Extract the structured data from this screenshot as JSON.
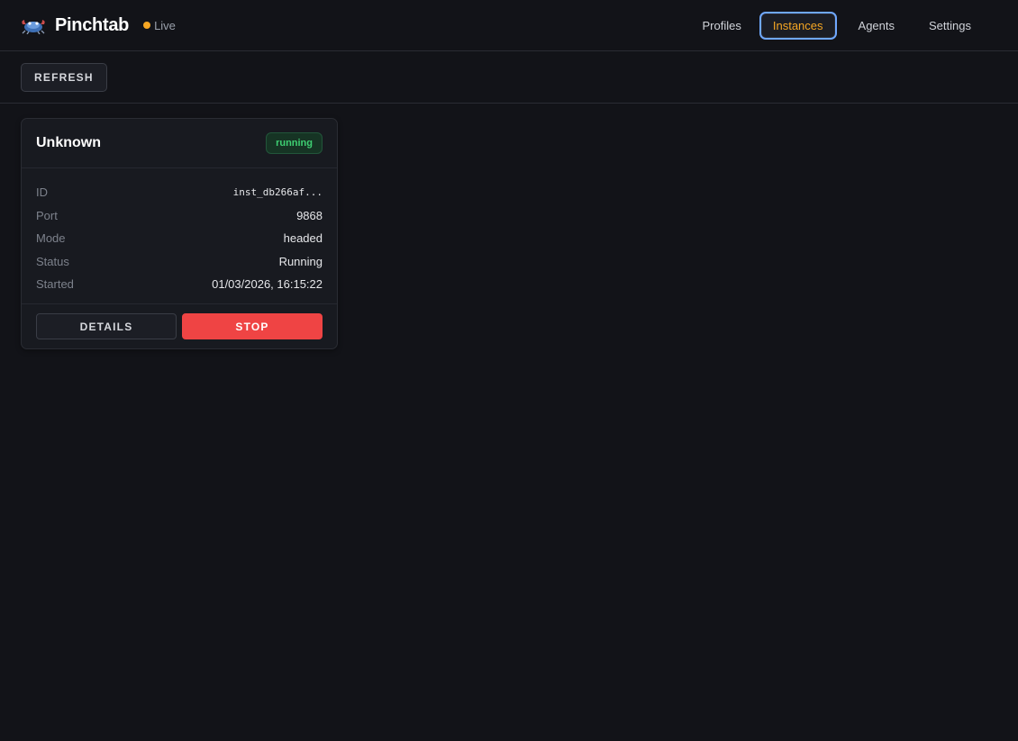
{
  "app": {
    "brand_name": "Pinchtab",
    "status_label": "Live",
    "status_color": "#f5a623",
    "logo_icon": "crab-logo-icon"
  },
  "nav": {
    "items": [
      {
        "label": "Profiles",
        "active": false
      },
      {
        "label": "Instances",
        "active": true
      },
      {
        "label": "Agents",
        "active": false
      },
      {
        "label": "Settings",
        "active": false
      }
    ]
  },
  "toolbar": {
    "refresh_label": "REFRESH"
  },
  "instance_card": {
    "title": "Unknown",
    "status_badge": "running",
    "fields": [
      {
        "key": "ID",
        "value": "inst_db266af..."
      },
      {
        "key": "Port",
        "value": "9868"
      },
      {
        "key": "Mode",
        "value": "headed"
      },
      {
        "key": "Status",
        "value": "Running"
      },
      {
        "key": "Started",
        "value": "01/03/2026, 16:15:22"
      }
    ],
    "details_label": "DETAILS",
    "stop_label": "STOP"
  },
  "colors": {
    "accent": "#f5a623",
    "active_outline": "#6fa8ff",
    "running": "#3ecf72",
    "danger": "#ef4444",
    "background": "#121318"
  }
}
